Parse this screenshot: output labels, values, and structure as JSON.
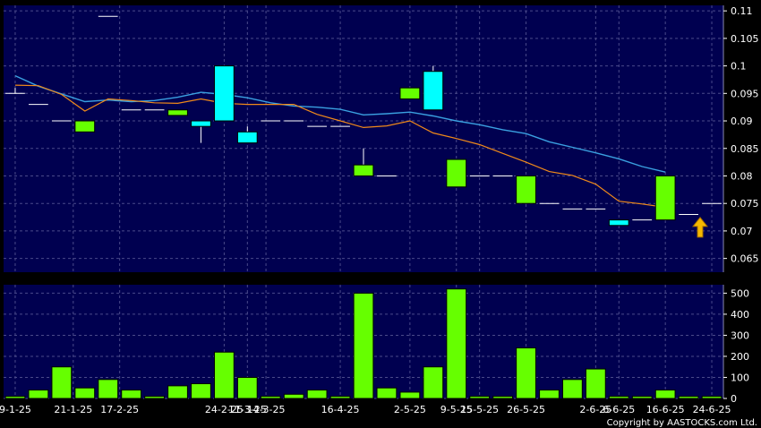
{
  "colors": {
    "background": "#000000",
    "plot_bg": "#000050",
    "grid": "#4a4a8a",
    "up_candle": "#00ffff",
    "down_candle": "#66ff00",
    "ma_blue": "#3aa0e0",
    "ma_orange": "#f08a1a",
    "volume_bar": "#66ff00",
    "arrow": "#f5b800",
    "text": "#ffffff"
  },
  "copyright": "Copyright by AASTOCKS.com Ltd.",
  "chart_data": [
    {
      "type": "candlestick",
      "ylim": [
        0.0625,
        0.111
      ],
      "yticks": [
        "0.065",
        "0.07",
        "0.075",
        "0.08",
        "0.085",
        "0.09",
        "0.095",
        "0.1",
        "0.105",
        "0.11"
      ],
      "grid": true,
      "candles": [
        {
          "o": 0.095,
          "h": 0.096,
          "l": 0.095,
          "c": 0.095
        },
        {
          "o": 0.093,
          "h": 0.093,
          "l": 0.093,
          "c": 0.093
        },
        {
          "o": 0.09,
          "h": 0.09,
          "l": 0.09,
          "c": 0.09
        },
        {
          "o": 0.09,
          "h": 0.09,
          "l": 0.088,
          "c": 0.088
        },
        {
          "o": 0.109,
          "h": 0.109,
          "l": 0.109,
          "c": 0.109
        },
        {
          "o": 0.092,
          "h": 0.092,
          "l": 0.092,
          "c": 0.092
        },
        {
          "o": 0.092,
          "h": 0.092,
          "l": 0.092,
          "c": 0.092
        },
        {
          "o": 0.092,
          "h": 0.092,
          "l": 0.091,
          "c": 0.091
        },
        {
          "o": 0.089,
          "h": 0.09,
          "l": 0.086,
          "c": 0.09
        },
        {
          "o": 0.09,
          "h": 0.1,
          "l": 0.09,
          "c": 0.1
        },
        {
          "o": 0.086,
          "h": 0.089,
          "l": 0.086,
          "c": 0.088
        },
        {
          "o": 0.09,
          "h": 0.09,
          "l": 0.09,
          "c": 0.09
        },
        {
          "o": 0.09,
          "h": 0.09,
          "l": 0.09,
          "c": 0.09
        },
        {
          "o": 0.089,
          "h": 0.089,
          "l": 0.089,
          "c": 0.089
        },
        {
          "o": 0.089,
          "h": 0.089,
          "l": 0.089,
          "c": 0.089
        },
        {
          "o": 0.082,
          "h": 0.085,
          "l": 0.08,
          "c": 0.08
        },
        {
          "o": 0.08,
          "h": 0.08,
          "l": 0.08,
          "c": 0.08
        },
        {
          "o": 0.096,
          "h": 0.096,
          "l": 0.094,
          "c": 0.094
        },
        {
          "o": 0.092,
          "h": 0.1,
          "l": 0.092,
          "c": 0.099
        },
        {
          "o": 0.083,
          "h": 0.083,
          "l": 0.078,
          "c": 0.078
        },
        {
          "o": 0.08,
          "h": 0.08,
          "l": 0.08,
          "c": 0.08
        },
        {
          "o": 0.08,
          "h": 0.08,
          "l": 0.08,
          "c": 0.08
        },
        {
          "o": 0.08,
          "h": 0.08,
          "l": 0.075,
          "c": 0.075
        },
        {
          "o": 0.075,
          "h": 0.075,
          "l": 0.075,
          "c": 0.075
        },
        {
          "o": 0.074,
          "h": 0.074,
          "l": 0.074,
          "c": 0.074
        },
        {
          "o": 0.074,
          "h": 0.074,
          "l": 0.074,
          "c": 0.074
        },
        {
          "o": 0.071,
          "h": 0.072,
          "l": 0.071,
          "c": 0.072
        },
        {
          "o": 0.072,
          "h": 0.072,
          "l": 0.072,
          "c": 0.072
        },
        {
          "o": 0.08,
          "h": 0.08,
          "l": 0.072,
          "c": 0.072
        },
        {
          "o": 0.073,
          "h": 0.073,
          "l": 0.073,
          "c": 0.073
        },
        {
          "o": 0.075,
          "h": 0.075,
          "l": 0.075,
          "c": 0.075
        }
      ],
      "ma_blue": [
        0.0982,
        0.0963,
        0.0949,
        0.0935,
        0.0938,
        0.0935,
        0.0937,
        0.0943,
        0.0952,
        0.0948,
        0.0942,
        0.0933,
        0.0927,
        0.0925,
        0.0921,
        0.0911,
        0.0913,
        0.0916,
        0.0909,
        0.09,
        0.0893,
        0.0884,
        0.0877,
        0.0862,
        0.0852,
        0.0842,
        0.0831,
        0.0817,
        0.0807
      ],
      "ma_orange": [
        0.0965,
        0.0964,
        0.0948,
        0.0918,
        0.094,
        0.0937,
        0.0933,
        0.0932,
        0.094,
        0.0932,
        0.093,
        0.093,
        0.093,
        0.0912,
        0.09,
        0.0888,
        0.0891,
        0.09,
        0.0878,
        0.0868,
        0.0857,
        0.0841,
        0.0825,
        0.0808,
        0.0801,
        0.0785,
        0.0754,
        0.0749,
        0.0743
      ],
      "arrow_value": 0.0705
    },
    {
      "type": "bar",
      "ylim": [
        0,
        540
      ],
      "yticks": [
        "0",
        "100",
        "200",
        "300",
        "400",
        "500"
      ],
      "grid": true,
      "values": [
        10,
        40,
        150,
        50,
        90,
        40,
        10,
        60,
        70,
        220,
        100,
        10,
        20,
        40,
        10,
        500,
        50,
        30,
        150,
        520,
        10,
        10,
        240,
        40,
        90,
        140,
        10,
        10,
        40,
        10,
        10
      ]
    }
  ],
  "x_labels": [
    {
      "index": 0,
      "text": "9-1-25"
    },
    {
      "index": 2.5,
      "text": "21-1-25"
    },
    {
      "index": 4.5,
      "text": "17-2-25"
    },
    {
      "index": 9.0,
      "text": "24-2-25"
    },
    {
      "index": 10.0,
      "text": "11-3-25"
    },
    {
      "index": 10.8,
      "text": "14-3-25"
    },
    {
      "index": 14.0,
      "text": "16-4-25"
    },
    {
      "index": 17.0,
      "text": "2-5-25"
    },
    {
      "index": 19.0,
      "text": "9-5-25"
    },
    {
      "index": 20.0,
      "text": "15-5-25"
    },
    {
      "index": 22.0,
      "text": "26-5-25"
    },
    {
      "index": 25.0,
      "text": "2-6-25"
    },
    {
      "index": 26.0,
      "text": "6-6-25"
    },
    {
      "index": 28.0,
      "text": "16-6-25"
    },
    {
      "index": 30.0,
      "text": "24-6-25"
    }
  ]
}
